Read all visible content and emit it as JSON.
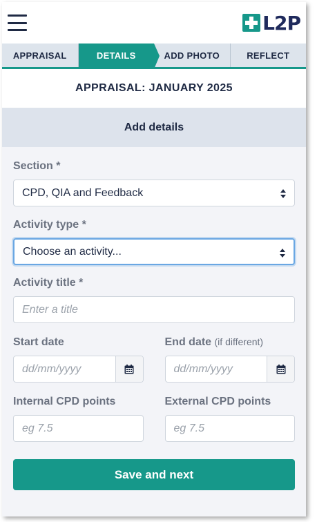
{
  "header": {
    "logo_text": "L2P",
    "menu_icon": "hamburger-menu-icon",
    "logo_icon": "plus-cross-icon"
  },
  "tabs": [
    {
      "label": "APPRAISAL",
      "active": false
    },
    {
      "label": "DETAILS",
      "active": true
    },
    {
      "label": "ADD PHOTO",
      "active": false
    },
    {
      "label": "REFLECT",
      "active": false
    }
  ],
  "page_title": "APPRAISAL: JANUARY 2025",
  "section_heading": "Add details",
  "form": {
    "section": {
      "label": "Section *",
      "value": "CPD, QIA and Feedback"
    },
    "activity_type": {
      "label": "Activity type *",
      "value": "Choose an activity..."
    },
    "activity_title": {
      "label": "Activity title *",
      "placeholder": "Enter a title"
    },
    "start_date": {
      "label": "Start date",
      "placeholder": "dd/mm/yyyy"
    },
    "end_date": {
      "label": "End date",
      "hint": "(if different)",
      "placeholder": "dd/mm/yyyy"
    },
    "internal_cpd": {
      "label": "Internal CPD points",
      "placeholder": "eg 7.5"
    },
    "external_cpd": {
      "label": "External CPD points",
      "placeholder": "eg 7.5"
    }
  },
  "save_button": "Save and next",
  "colors": {
    "accent": "#16988a",
    "navy": "#1f2a44",
    "focus": "#6aa7e3"
  }
}
